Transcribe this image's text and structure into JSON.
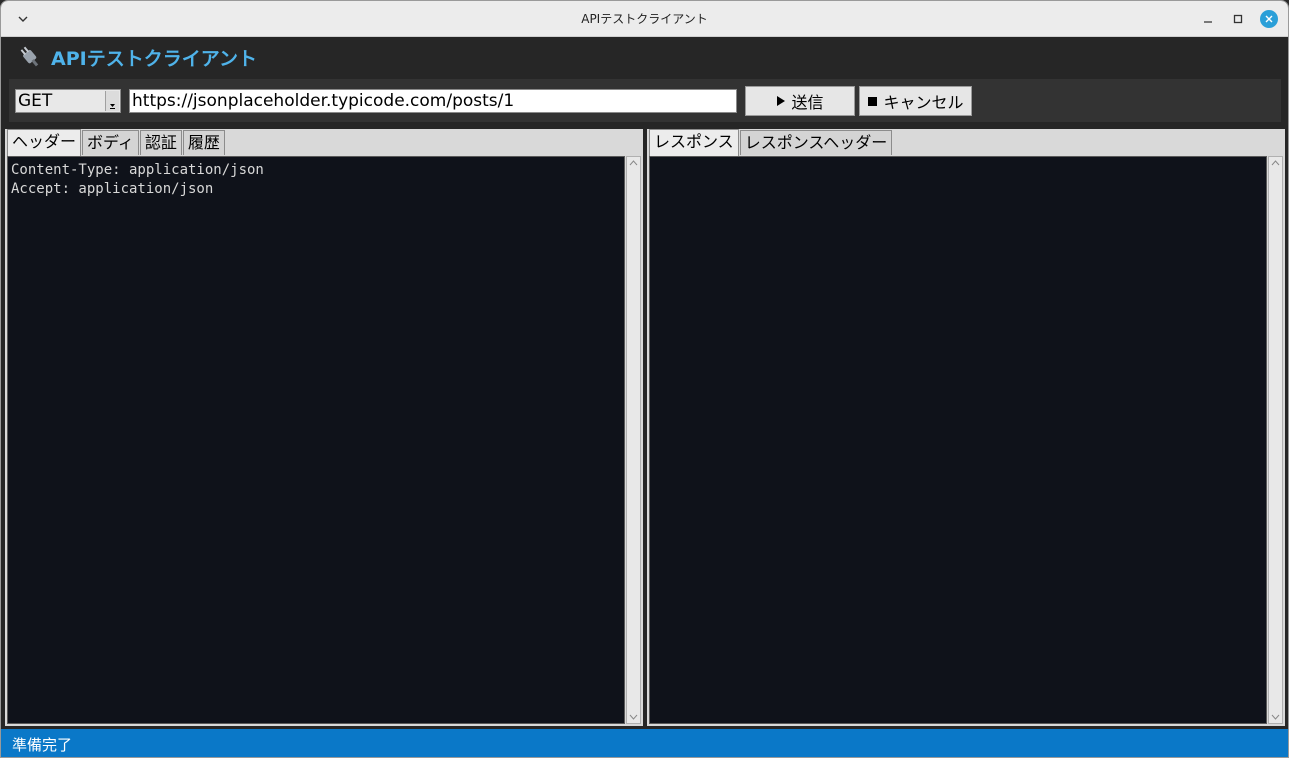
{
  "window": {
    "title": "APIテストクライアント"
  },
  "header": {
    "app_title": "APIテストクライアント",
    "icon": "plug-icon",
    "accent_color": "#4fb3ea"
  },
  "toolbar": {
    "method": "GET",
    "url": "https://jsonplaceholder.typicode.com/posts/1",
    "send_label": "送信",
    "cancel_label": "キャンセル"
  },
  "request_panel": {
    "tabs": [
      {
        "label": "ヘッダー",
        "active": true
      },
      {
        "label": "ボディ",
        "active": false
      },
      {
        "label": "認証",
        "active": false
      },
      {
        "label": "履歴",
        "active": false
      }
    ],
    "content": "Content-Type: application/json\nAccept: application/json"
  },
  "response_panel": {
    "tabs": [
      {
        "label": "レスポンス",
        "active": true
      },
      {
        "label": "レスポンスヘッダー",
        "active": false
      }
    ],
    "content": ""
  },
  "status": {
    "text": "準備完了",
    "color": "#0a78c8"
  }
}
